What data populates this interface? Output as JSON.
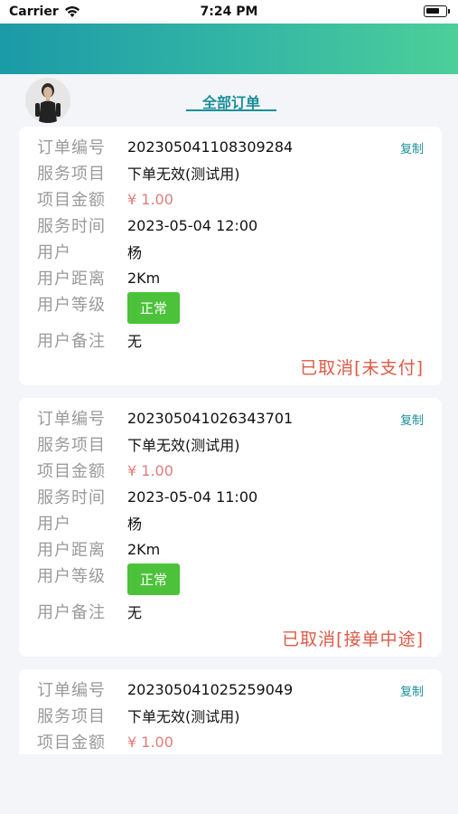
{
  "status_bar": {
    "carrier": "Carrier",
    "time": "7:24 PM"
  },
  "tabs": {
    "active": "全部订单"
  },
  "labels": {
    "order_no": "订单编号",
    "service": "服务项目",
    "amount": "项目金额",
    "service_time": "服务时间",
    "user": "用户",
    "distance": "用户距离",
    "level": "用户等级",
    "remark": "用户备注",
    "copy": "复制"
  },
  "orders": [
    {
      "order_no": "202305041108309284",
      "service": "下单无效(测试用)",
      "amount": "¥ 1.00",
      "service_time": "2023-05-04 12:00",
      "user": "杨",
      "distance": "2Km",
      "level": "正常",
      "remark": "无",
      "status": "已取消[未支付]"
    },
    {
      "order_no": "202305041026343701",
      "service": "下单无效(测试用)",
      "amount": "¥ 1.00",
      "service_time": "2023-05-04 11:00",
      "user": "杨",
      "distance": "2Km",
      "level": "正常",
      "remark": "无",
      "status": "已取消[接单中途]"
    },
    {
      "order_no": "202305041025259049",
      "service": "下单无效(测试用)",
      "amount": "¥ 1.00"
    }
  ]
}
